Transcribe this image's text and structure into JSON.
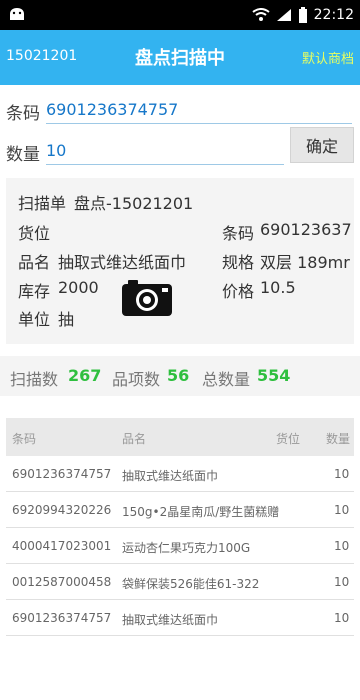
{
  "status_bar": {
    "time": "22:12"
  },
  "app_bar": {
    "left_text": "15021201",
    "title": "盘点扫描中",
    "right_link": "默认商档"
  },
  "form": {
    "barcode_label": "条码",
    "barcode_value": "6901236374757",
    "qty_label": "数量",
    "qty_value": "10",
    "confirm_label": "确定"
  },
  "info": {
    "scan_sheet_label": "扫描单",
    "scan_sheet_value": "盘点-15021201",
    "location_label": "货位",
    "location_value": "",
    "barcode_label": "条码",
    "barcode_value": "690123637",
    "name_label": "品名",
    "name_value": "抽取式维达纸面巾",
    "spec_label": "规格",
    "spec_value": "双层 189mr",
    "stock_label": "库存",
    "stock_value": "2000",
    "price_label": "价格",
    "price_value": "10.5",
    "unit_label": "单位",
    "unit_value": "抽"
  },
  "stats": {
    "scans_label": "扫描数",
    "scans_value": "267",
    "items_label": "品项数",
    "items_value": "56",
    "total_label": "总数量",
    "total_value": "554"
  },
  "table": {
    "headers": [
      "条码",
      "品名",
      "货位",
      "数量"
    ],
    "rows": [
      {
        "barcode": "6901236374757",
        "name": "抽取式维达纸面巾",
        "location": "",
        "qty": "10"
      },
      {
        "barcode": "6920994320226",
        "name": "150g•2晶星南瓜/野生菌糕赠",
        "location": "",
        "qty": "10"
      },
      {
        "barcode": "4000417023001",
        "name": "运动杏仁果巧克力100G",
        "location": "",
        "qty": "10"
      },
      {
        "barcode": "0012587000458",
        "name": "袋鲜保装526能佳61-322",
        "location": "",
        "qty": "10"
      },
      {
        "barcode": "6901236374757",
        "name": "抽取式维达纸面巾",
        "location": "",
        "qty": "10"
      }
    ]
  },
  "colors": {
    "app_bar": "#33b3f0",
    "accent_text": "#1677c9",
    "stat_number": "#2fbf3f",
    "right_link": "#e8ff60"
  },
  "icons": [
    "android-icon",
    "wifi-icon",
    "signal-icon",
    "battery-icon",
    "camera-icon"
  ]
}
